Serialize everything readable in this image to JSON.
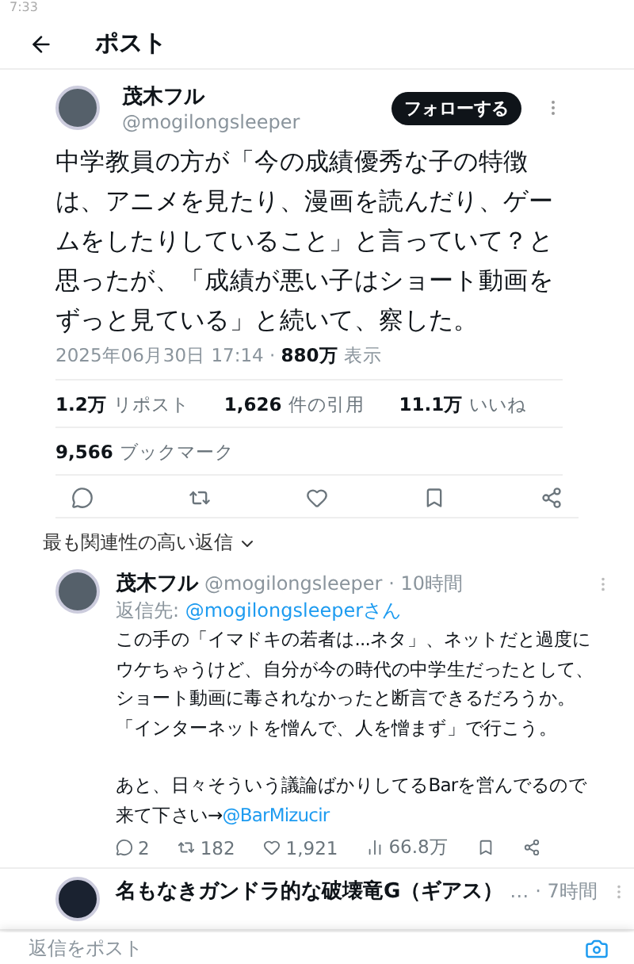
{
  "status_bar": {
    "time": "7:33"
  },
  "header": {
    "title": "ポスト"
  },
  "post": {
    "author": {
      "name": "茂木フル",
      "handle": "@mogilongsleeper"
    },
    "follow_button": "フォローする",
    "text": "中学教員の方が「今の成績優秀な子の特徴は、アニメを見たり、漫画を読んだり、ゲームをしたりしていること」と言っていて？と思ったが、「成績が悪い子はショート動画をずっと見ている」と続いて、察した。",
    "timestamp": "2025年06月30日 17:14 · ",
    "views": "880万",
    "views_label": "表示",
    "stats": [
      {
        "value": "1.2万",
        "label": "リポスト"
      },
      {
        "value": "1,626",
        "label": "件の引用"
      },
      {
        "value": "11.1万",
        "label": "いいね"
      }
    ],
    "bookmarks": {
      "value": "9,566",
      "label": "ブックマーク"
    }
  },
  "replies_sort": "最も関連性の高い返信",
  "replies": [
    {
      "name": "茂木フル",
      "handle": "@mogilongsleeper",
      "time": "· 10時間",
      "reply_to_label": "返信先: ",
      "reply_to": "@mogilongsleeperさん",
      "paragraphs": [
        {
          "text": "この手の「イマドキの若者は...ネタ」、ネットだと過度にウケちゃうけど、自分が今の時代の中学生だったとして、ショート動画に毒されなかったと断言できるだろうか。"
        },
        {
          "text": "「インターネットを憎んで、人を憎まず」で行こう。"
        },
        {
          "text": "あと、日々そういう議論ばかりしてるBarを営んでるので来て下さい→",
          "link": "@BarMizucir",
          "blank_before": true
        }
      ],
      "metrics": [
        "2",
        "182",
        "1,921",
        "66.8万"
      ]
    },
    {
      "name": "名もなきガンドラ的な破壊竜G（ギアス）",
      "handle": "…",
      "time": "· 7時間"
    }
  ],
  "compose": {
    "placeholder": "返信をポスト"
  }
}
